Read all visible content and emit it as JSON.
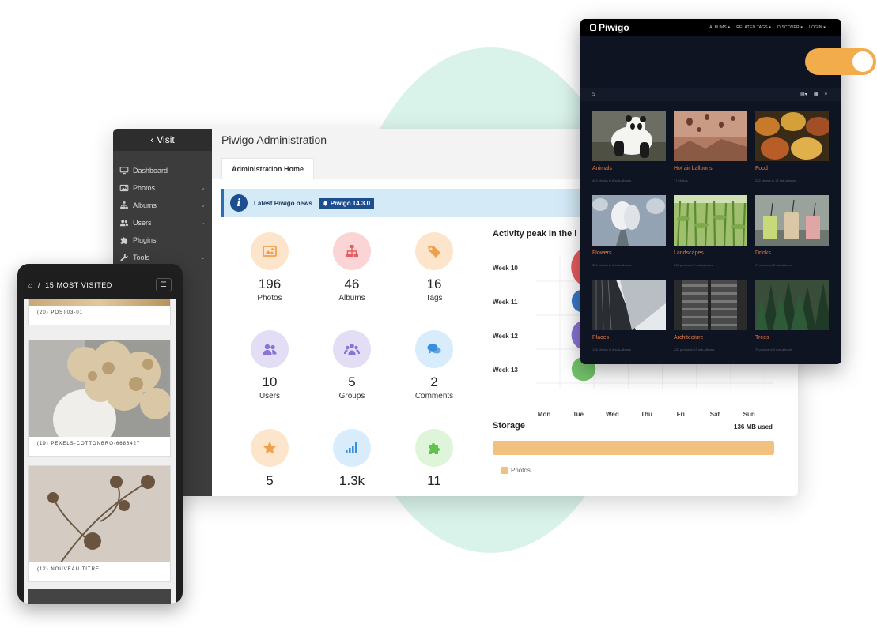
{
  "admin": {
    "visit_label": "Visit",
    "title": "Piwigo Administration",
    "active_tab": "Administration Home",
    "sidebar": [
      {
        "label": "Dashboard",
        "icon": "monitor-icon",
        "expandable": false
      },
      {
        "label": "Photos",
        "icon": "image-icon",
        "expandable": true
      },
      {
        "label": "Albums",
        "icon": "sitemap-icon",
        "expandable": true
      },
      {
        "label": "Users",
        "icon": "users-icon",
        "expandable": true
      },
      {
        "label": "Plugins",
        "icon": "puzzle-icon",
        "expandable": false
      },
      {
        "label": "Tools",
        "icon": "wrench-icon",
        "expandable": true
      }
    ],
    "news": {
      "label": "Latest Piwigo news",
      "badge": "Piwigo 14.3.0"
    },
    "stats": [
      {
        "value": "196",
        "label": "Photos",
        "icon": "image-icon",
        "bg": "#fde5cc",
        "fg": "#f0a04b"
      },
      {
        "value": "46",
        "label": "Albums",
        "icon": "sitemap-icon",
        "bg": "#fbd5d6",
        "fg": "#e85c5f"
      },
      {
        "value": "16",
        "label": "Tags",
        "icon": "tag-icon",
        "bg": "#fde5cc",
        "fg": "#f0a04b"
      },
      {
        "value": "10",
        "label": "Users",
        "icon": "users-icon",
        "bg": "#e4ddf6",
        "fg": "#8a73d4"
      },
      {
        "value": "5",
        "label": "Groups",
        "icon": "group-icon",
        "bg": "#e4ddf6",
        "fg": "#8a73d4"
      },
      {
        "value": "2",
        "label": "Comments",
        "icon": "comments-icon",
        "bg": "#d9ecfb",
        "fg": "#3a8fdc"
      },
      {
        "value": "5",
        "label": "",
        "icon": "star-icon",
        "bg": "#fde5cc",
        "fg": "#f0a04b"
      },
      {
        "value": "1.3k",
        "label": "",
        "icon": "signal-icon",
        "bg": "#d9ecfb",
        "fg": "#3a8fdc"
      },
      {
        "value": "11",
        "label": "",
        "icon": "puzzle-icon",
        "bg": "#dff5d9",
        "fg": "#63c24f"
      }
    ],
    "activity_title": "Activity peak in the l",
    "storage": {
      "title": "Storage",
      "used": "136 MB used",
      "legend": "Photos",
      "fill_fraction": 1.0,
      "color": "#f2c07f"
    }
  },
  "chart_data": {
    "type": "scatter",
    "title": "Activity peak in the l",
    "xlabel": "",
    "ylabel": "",
    "x_categories": [
      "Mon",
      "Tue",
      "Wed",
      "Thu",
      "Fri",
      "Sat",
      "Sun"
    ],
    "y_categories": [
      "Week 10",
      "Week 11",
      "Week 12",
      "Week 13"
    ],
    "points": [
      {
        "x": "Tue",
        "y": "Week 10",
        "size": 1.0,
        "color": "#e85c5f"
      },
      {
        "x": "Tue",
        "y": "Week 11",
        "size": 0.35,
        "color": "#3a78c9"
      },
      {
        "x": "Tue",
        "y": "Week 12",
        "size": 0.62,
        "color": "#8a73d4"
      },
      {
        "x": "Tue",
        "y": "Week 13",
        "size": 0.38,
        "color": "#73c46a"
      }
    ],
    "grid": true
  },
  "gallery": {
    "logo": "Piwigo",
    "nav": [
      "ALBUMS ▾",
      "RELATED TAGS ▾",
      "DISCOVER ▾",
      "LOGIN ▾"
    ],
    "albums": [
      {
        "title": "Animals",
        "meta": "420 photos in 6 sub-albums",
        "photo": "panda"
      },
      {
        "title": "Hot air balloons",
        "meta": "17 photos",
        "photo": "balloons"
      },
      {
        "title": "Food",
        "meta": "252 photos in 12 sub-albums",
        "photo": "food"
      },
      {
        "title": "Flowers",
        "meta": "329 photos in 9 sub-albums",
        "photo": "flowers"
      },
      {
        "title": "Landscapes",
        "meta": "362 photos in 9 sub-albums",
        "photo": "cornfield"
      },
      {
        "title": "Drinks",
        "meta": "97 photos in 3 sub-albums",
        "photo": "drinks"
      },
      {
        "title": "Places",
        "meta": "138 photos in 4 sub-albums",
        "photo": "building"
      },
      {
        "title": "Architecture",
        "meta": "220 photos in 13 sub-albums",
        "photo": "tower"
      },
      {
        "title": "Trees",
        "meta": "79 photos in 3 sub-albums",
        "photo": "forest"
      }
    ]
  },
  "mobile": {
    "title": "15 MOST VISITED",
    "items": [
      {
        "caption": "(20) POST03-01"
      },
      {
        "caption": "(19) PEXELS-COTTONBRO-6686427"
      },
      {
        "caption": "(12) NOUVEAU TITRE"
      }
    ]
  },
  "colors": {
    "accent_orange": "#f2ac4c",
    "sidebar_dark": "#3c3c3c",
    "news_blue": "#1d4f8f",
    "album_title": "#e07b48"
  }
}
